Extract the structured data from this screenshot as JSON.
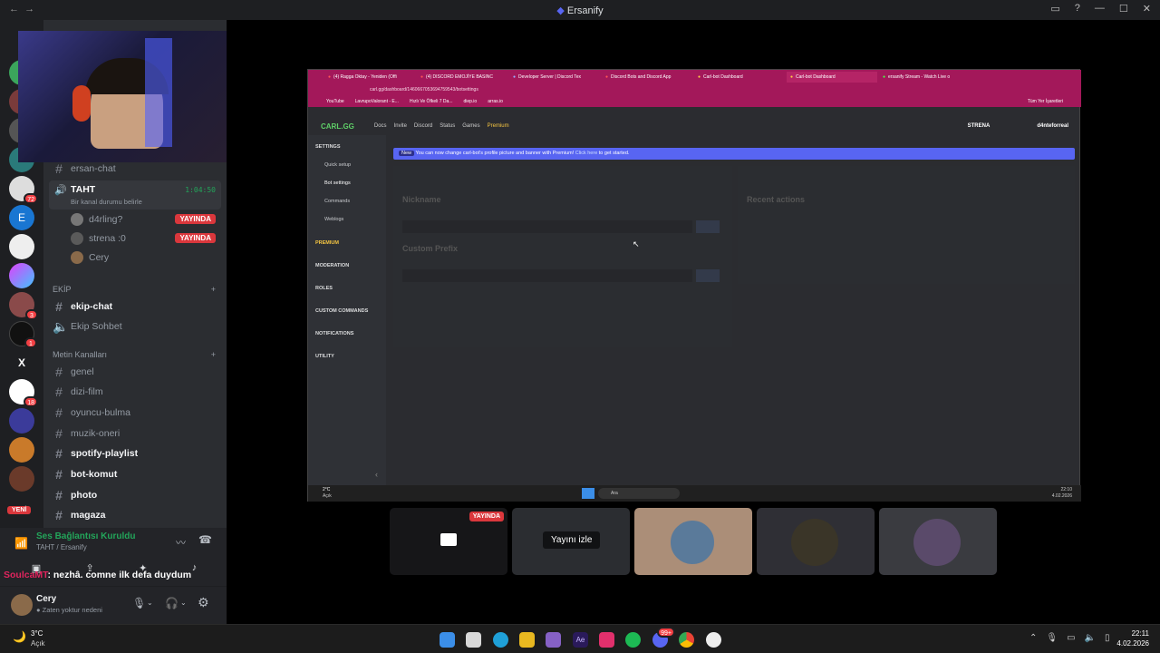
{
  "window": {
    "title": "Ersanify"
  },
  "channels": {
    "ersan_chat": "ersan-chat",
    "voice_channel": {
      "name": "TAHT",
      "timer": "1:04:50",
      "status": "Bir kanal durumu belirle"
    },
    "voice_users": [
      {
        "name": "d4rling?",
        "badge": "YAYINDA"
      },
      {
        "name": "strena :0",
        "badge": "YAYINDA"
      },
      {
        "name": "Cery",
        "badge": ""
      }
    ],
    "cat_ekip": "EKİP",
    "ekip_chat": "ekip-chat",
    "ekip_sohbet": "Ekip Sohbet",
    "cat_metin": "Metin Kanalları",
    "text_channels": [
      "genel",
      "dizi-film",
      "oyuncu-bulma",
      "muzik-oneri",
      "spotify-playlist",
      "bot-komut",
      "photo",
      "magaza"
    ],
    "new_badge": "YENİ"
  },
  "servers": {
    "badges": [
      "72",
      "3",
      "1",
      "18"
    ],
    "x_label": "X"
  },
  "voice": {
    "status": "Ses Bağlantısı Kuruldu",
    "location": "TAHT / Ersanify",
    "overlay_user": "SoulcaMT",
    "overlay_msg": ": nezhâ. comne ilk defa duydum"
  },
  "user": {
    "name": "Cery",
    "status": "Zaten yoktur nedeni"
  },
  "screenshare": {
    "tabs": [
      "(4) Ragga Oktay - Yeniden (Offi",
      "(4) DISCORD EMOJİYE BASINC",
      "Developer Server | Discord Tex",
      "Discord Bots and Discord App",
      "Carl-bot Dashboard",
      "Carl-bot Dashboard",
      "ersanify Stream - Watch Live o"
    ],
    "url": "carl.gg/dashboard/1460667053694759543/botsettings",
    "bookmarks": [
      "YouTube",
      "LavrupoValorant - E...",
      "Hızlı Ve Öfkeli 7 Da...",
      "diep.io",
      "arras.io"
    ],
    "all_bookmarks": "Tüm Yer İşaretleri",
    "carl_logo": "CARL.GG",
    "nav": [
      "Docs",
      "Invite",
      "Discord",
      "Status",
      "Games",
      "Premium"
    ],
    "carl_user": "STRENA",
    "carl_user2": "d4nteforreal",
    "sidebar_settings": "SETTINGS",
    "sidebar_items": [
      "Quick setup",
      "Bot settings",
      "Commands",
      "Weblogs"
    ],
    "sidebar_sections": [
      "PREMIUM",
      "MODERATION",
      "ROLES",
      "CUSTOM COMMANDS",
      "NOTIFICATIONS",
      "UTILITY"
    ],
    "banner_new": "New",
    "banner_text": "You can now change carl-bot's profile picture and banner with Premium!",
    "banner_link": "Click here",
    "banner_tail": "to get started.",
    "nickname_label": "Nickname",
    "prefix_label": "Custom Prefix",
    "recent_label": "Recent actions",
    "inner_weather": "2°C",
    "inner_weather_sub": "Açık",
    "inner_search": "Ara",
    "inner_time": "22:10",
    "inner_date": "4.02.2026"
  },
  "tiles": {
    "live_label": "YAYINDA",
    "watch_label": "Yayını izle"
  },
  "taskbar": {
    "weather_temp": "3°C",
    "weather_desc": "Açık",
    "time": "22:11",
    "date": "4.02.2026",
    "badge": "99+"
  }
}
